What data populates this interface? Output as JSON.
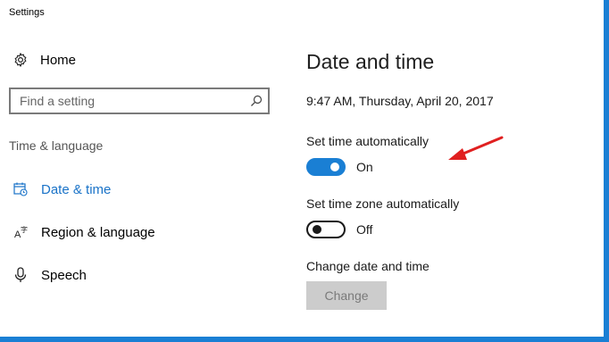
{
  "window": {
    "title": "Settings"
  },
  "sidebar": {
    "home_label": "Home",
    "search_placeholder": "Find a setting",
    "section_label": "Time & language",
    "items": [
      {
        "label": "Date & time",
        "icon": "calendar-clock-icon",
        "active": true
      },
      {
        "label": "Region & language",
        "icon": "region-language-icon",
        "active": false
      },
      {
        "label": "Speech",
        "icon": "microphone-icon",
        "active": false
      }
    ]
  },
  "main": {
    "title": "Date and time",
    "current_datetime": "9:47 AM, Thursday, April 20, 2017",
    "set_time_auto": {
      "label": "Set time automatically",
      "state": "On"
    },
    "set_timezone_auto": {
      "label": "Set time zone automatically",
      "state": "Off"
    },
    "change_section": {
      "label": "Change date and time",
      "button": "Change"
    }
  },
  "colors": {
    "accent": "#1a7fd4",
    "annotation_arrow": "#e02020"
  }
}
